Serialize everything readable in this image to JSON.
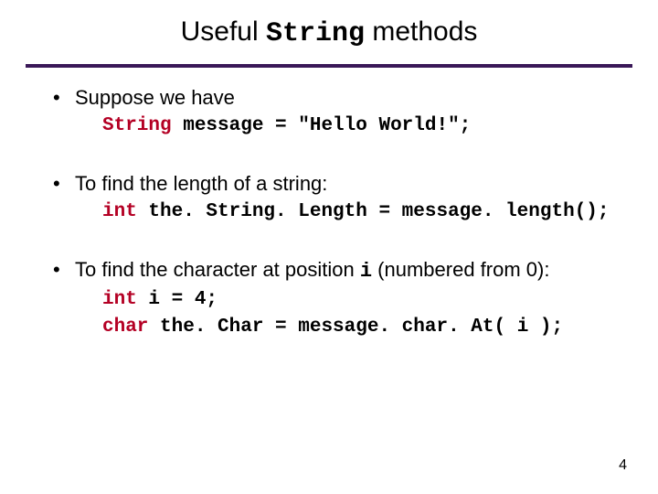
{
  "title": {
    "prefix": "Useful ",
    "code": "String",
    "suffix": " methods"
  },
  "bullets": [
    {
      "text": "Suppose we have",
      "code_lines": [
        {
          "kw": "String",
          "rest": " message = \"Hello World!\";"
        }
      ]
    },
    {
      "text": "To find the length of a string:",
      "code_lines": [
        {
          "kw": "int",
          "rest": " the. String. Length = message. length();"
        }
      ]
    },
    {
      "text_pre": "To find the character at position ",
      "code_inline": "i",
      "text_post": " (numbered from 0):",
      "code_lines": [
        {
          "kw": "int",
          "rest": " i = 4;"
        },
        {
          "kw": "char",
          "rest": " the. Char = message. char. At( i );"
        }
      ]
    }
  ],
  "page_number": "4"
}
